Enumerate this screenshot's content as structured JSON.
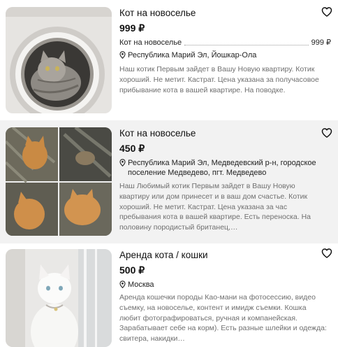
{
  "listings": [
    {
      "title": "Кот на новоселье",
      "price": "999 ₽",
      "price_row_label": "Кот на новоселье",
      "price_row_value": "999 ₽",
      "location": "Республика Марий Эл, Йошкар-Ола",
      "description": "Наш котик Первым зайдет в Вашу Новую квартиру. Котик хороший. Не метит. Кастрат. Цена указана за получасовое прибывание кота в вашей квартире. На поводке.",
      "photo_icon": "cat-in-washing-machine-photo",
      "fav_icon": "heart-icon"
    },
    {
      "title": "Кот на новоселье",
      "price": "450 ₽",
      "location": "Республика Марий Эл, Медведевский р-н, городское поселение Медведево, пгт. Медведево",
      "description": "Наш Любимый котик Первым зайдет в Вашу Новую квартиру или дом принесет и в ваш дом счастье. Котик хороший. Не метит. Кастрат. Цена указана за час пребывания кота в вашей квартире. Есть переноска. На половину породистый британец,…",
      "photo_icon": "ginger-cat-collage-photo",
      "fav_icon": "heart-icon"
    },
    {
      "title": "Аренда кота / кошки",
      "price": "500 ₽",
      "location": "Москва",
      "description": "Аренда кошечки породы Као-мани на фотосессию, видео съемку, на новоселье, контент и имидж съемки. Кошка любит фотографироваться, ручная и компанейская. Зарабатывает себе на корм). Есть разные шлейки и одежда: свитера, накидки…",
      "photo_icon": "white-cat-photo",
      "fav_icon": "heart-icon"
    }
  ]
}
